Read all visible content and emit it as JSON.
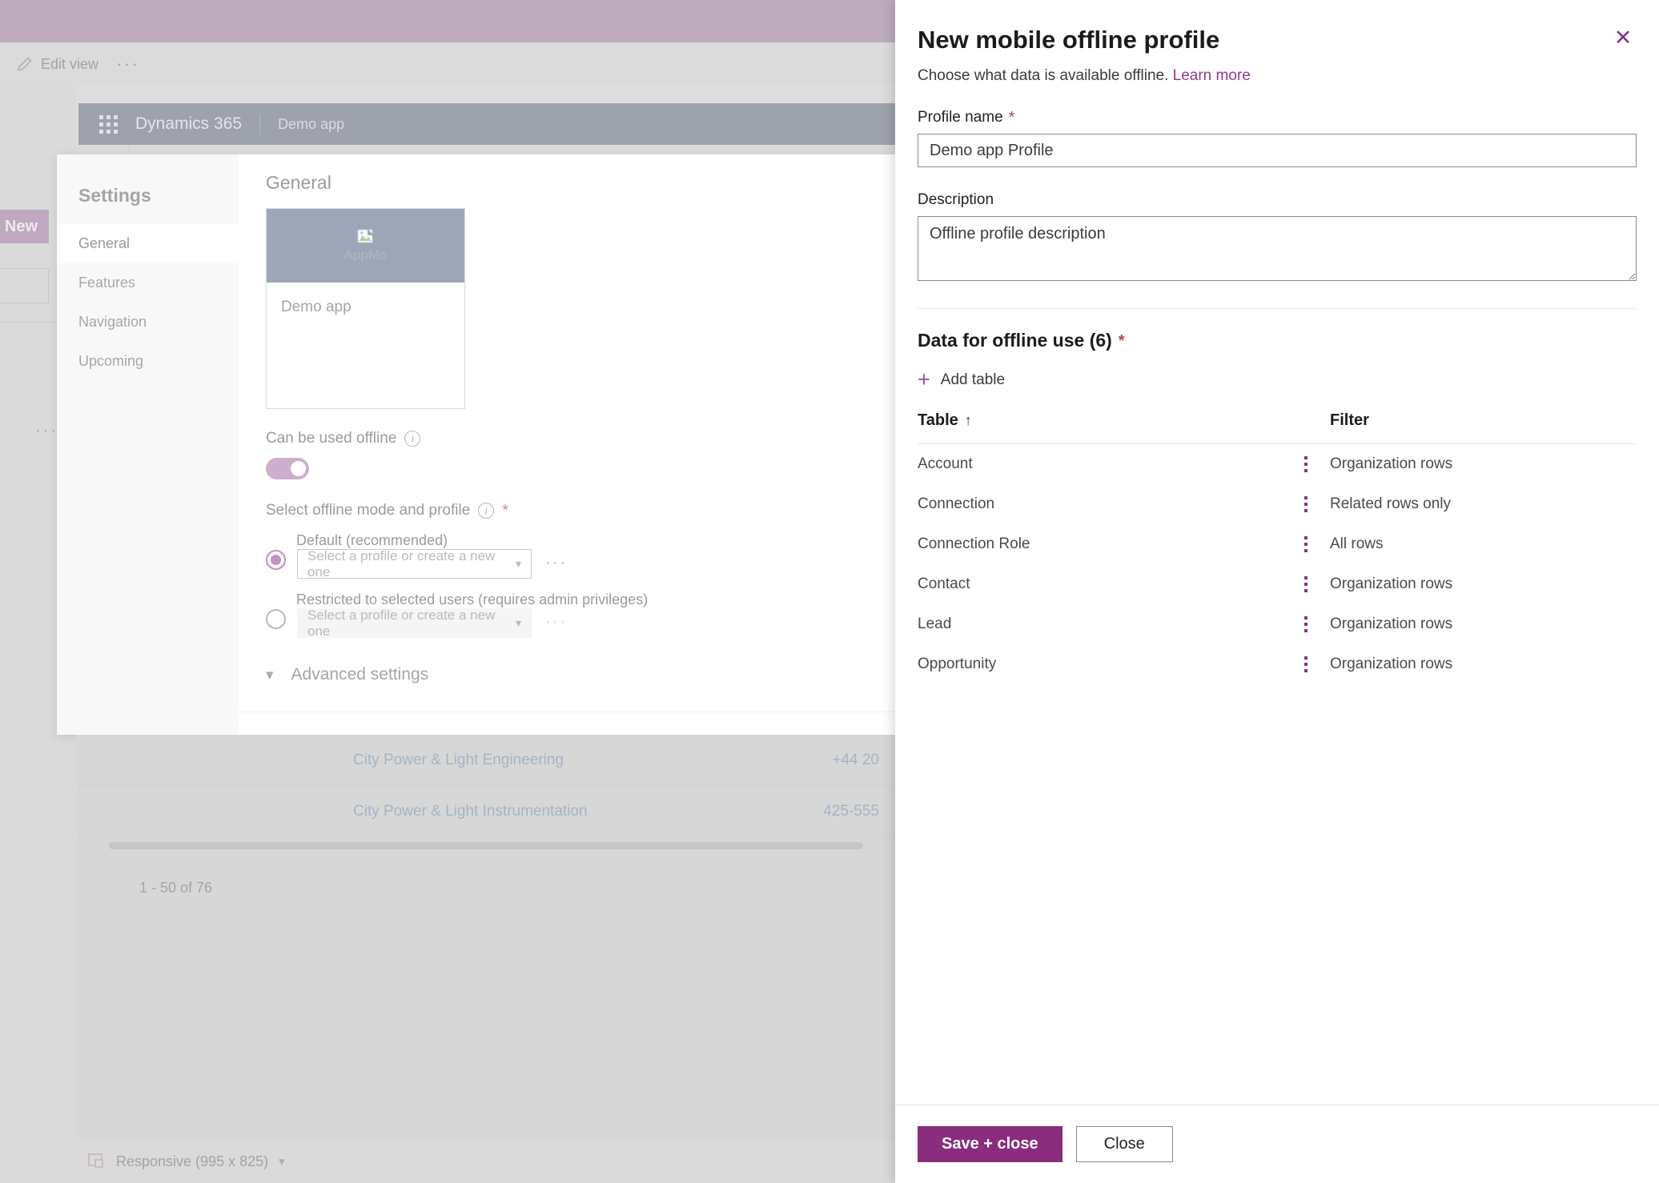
{
  "background": {
    "command_bar": {
      "edit_view_label": "Edit view",
      "overflow_label": "···"
    },
    "left_rail": {
      "new_button": "New",
      "overflow": "···"
    },
    "app_header": {
      "product": "Dynamics 365",
      "app_name": "Demo app"
    },
    "settings_dialog": {
      "nav_title": "Settings",
      "nav_items": [
        {
          "label": "General",
          "active": true
        },
        {
          "label": "Features",
          "active": false
        },
        {
          "label": "Navigation",
          "active": false
        },
        {
          "label": "Upcoming",
          "active": false
        }
      ],
      "main_title": "General",
      "app_card": {
        "image_alt": "AppMo",
        "name": "Demo app"
      },
      "offline_toggle_label": "Can be used offline",
      "offline_toggle_state": "on",
      "offline_mode_label": "Select offline mode and profile",
      "mode_options": [
        {
          "label": "Default (recommended)",
          "selected": true,
          "combo_placeholder": "Select a profile or create a new one",
          "overflow": "···",
          "disabled": false
        },
        {
          "label": "Restricted to selected users (requires admin privileges)",
          "selected": false,
          "combo_placeholder": "Select a profile or create a new one",
          "overflow": "···",
          "disabled": true
        }
      ],
      "advanced_settings_label": "Advanced settings"
    },
    "grid": {
      "rows": [
        {
          "name": "City Power & Light Engineering",
          "phone": "+44 20"
        },
        {
          "name": "City Power & Light Instrumentation",
          "phone": "425-555"
        }
      ],
      "pager": "1 - 50 of 76"
    },
    "status_bar": {
      "label": "Responsive (995 x 825)"
    }
  },
  "panel": {
    "title": "New mobile offline profile",
    "subtitle": "Choose what data is available offline.",
    "learn_more": "Learn more",
    "close_label": "✕",
    "profile_name": {
      "label": "Profile name",
      "required_mark": "*",
      "value": "Demo app Profile"
    },
    "description": {
      "label": "Description",
      "value": "Offline profile description"
    },
    "data_section": {
      "title": "Data for offline use (6)",
      "required_mark": "*",
      "add_table_label": "Add table",
      "columns": {
        "table": "Table",
        "sort_arrow": "↑",
        "filter": "Filter"
      },
      "rows": [
        {
          "table": "Account",
          "filter": "Organization rows"
        },
        {
          "table": "Connection",
          "filter": "Related rows only"
        },
        {
          "table": "Connection Role",
          "filter": "All rows"
        },
        {
          "table": "Contact",
          "filter": "Organization rows"
        },
        {
          "table": "Lead",
          "filter": "Organization rows"
        },
        {
          "table": "Opportunity",
          "filter": "Organization rows"
        }
      ]
    },
    "footer": {
      "save_label": "Save + close",
      "close_label": "Close"
    }
  },
  "colors": {
    "accent_purple": "#8a2d7d",
    "link_purple": "#913a91",
    "required_red": "#b4464d",
    "header_slate": "#62697a",
    "brand_band": "#967a96"
  }
}
